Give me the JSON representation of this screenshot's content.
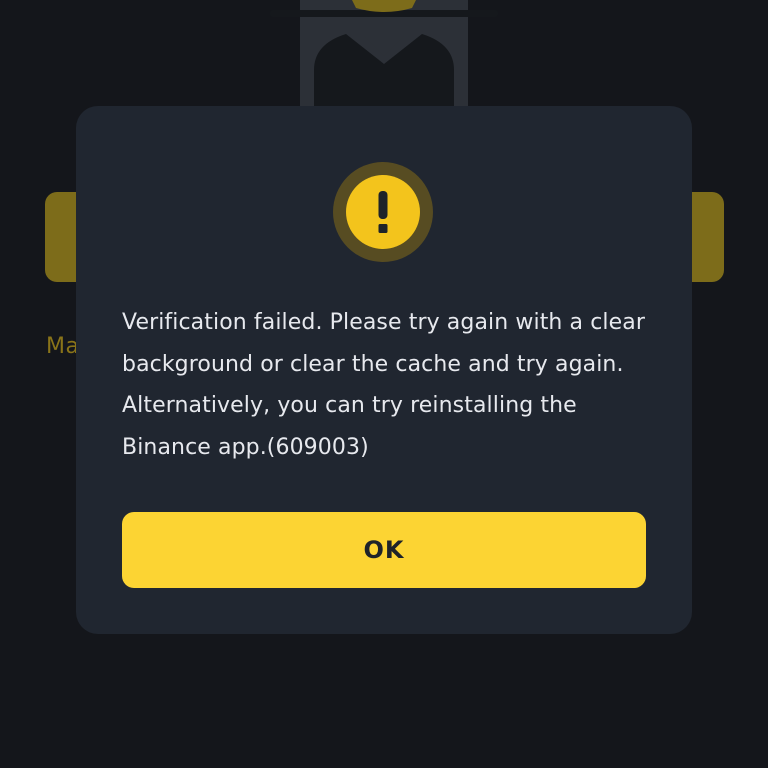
{
  "background": {
    "link_text": "Ma"
  },
  "dialog": {
    "icon": "exclamation-warning-icon",
    "message": "Verification failed. Please try again with a clear background or clear the cache and try again. Alternatively, you can try reinstalling the Binance app.(609003)",
    "ok_label": "OK"
  },
  "colors": {
    "screen_bg": "#14161b",
    "dialog_bg": "#202630",
    "accent_yellow": "#fcd433",
    "dimmed_yellow": "#7d6c1a",
    "text": "#e7e9ee"
  }
}
